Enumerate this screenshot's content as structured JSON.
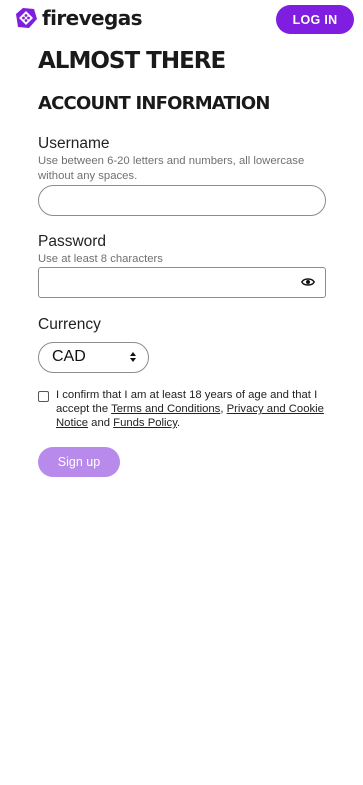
{
  "header": {
    "brand": "firevegas",
    "login_label": "LOG IN"
  },
  "page": {
    "title": "ALMOST THERE",
    "section_title": "ACCOUNT INFORMATION"
  },
  "form": {
    "username": {
      "label": "Username",
      "hint": "Use between 6-20 letters and numbers, all lowercase without any spaces.",
      "value": ""
    },
    "password": {
      "label": "Password",
      "hint": "Use at least 8 characters",
      "value": ""
    },
    "currency": {
      "label": "Currency",
      "selected": "CAD"
    },
    "consent": {
      "checked": false,
      "text_1": "I confirm that I am at least 18 years of age and that I accept the ",
      "link_terms": "Terms and Conditions",
      "text_2": ", ",
      "link_privacy": "Privacy and Cookie Notice",
      "text_3": " and ",
      "link_funds": "Funds Policy",
      "text_4": "."
    },
    "submit_label": "Sign up"
  },
  "colors": {
    "brand_purple": "#7f1de0",
    "signup_disabled": "#b88aeb"
  },
  "icons": {
    "logo": "dice-logo-icon",
    "password_toggle": "eye-icon",
    "select_arrows": "sort-arrows-icon"
  }
}
